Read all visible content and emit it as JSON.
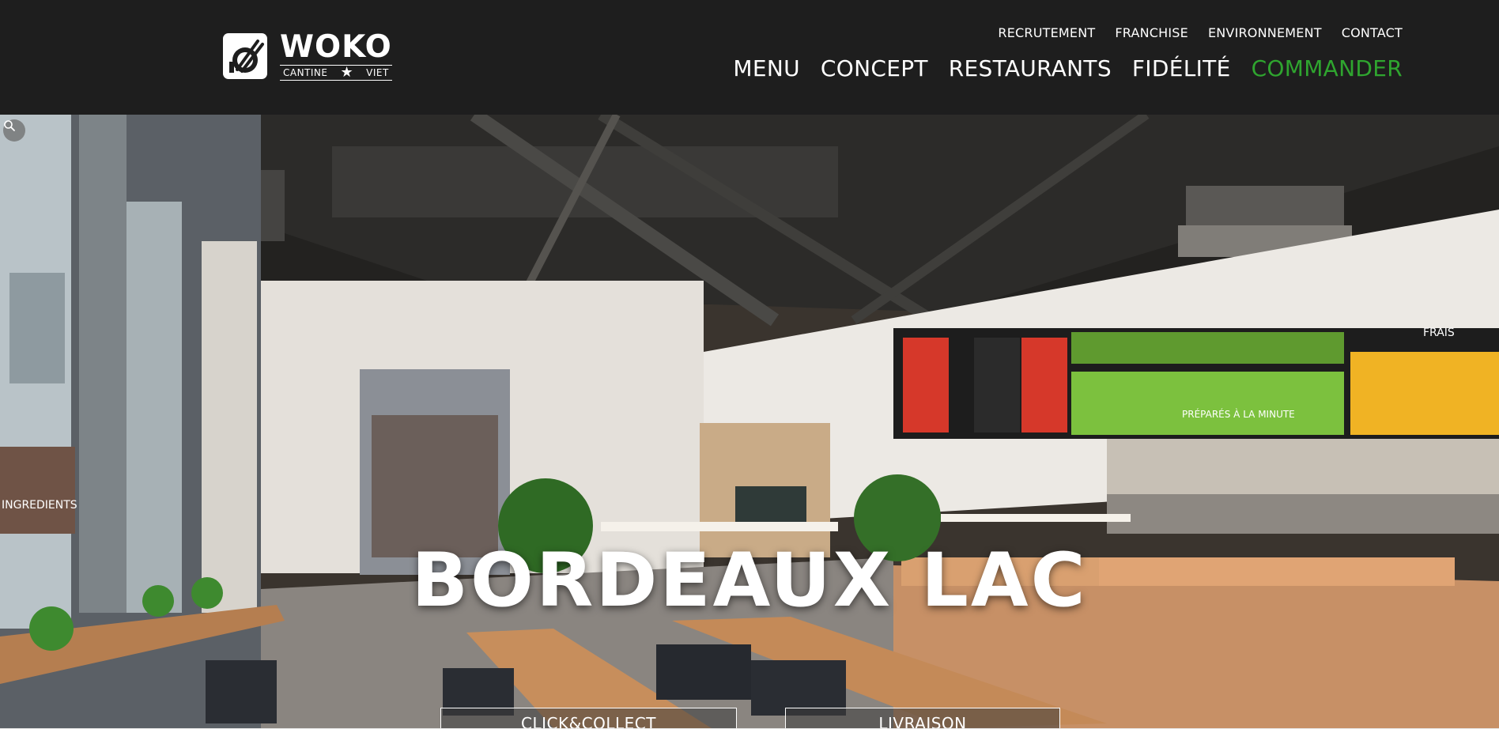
{
  "brand": {
    "logo_word": "WOKO",
    "logo_sub_left": "CANTINE",
    "logo_sub_right": "VIET"
  },
  "top_nav": [
    {
      "label": "RECRUTEMENT"
    },
    {
      "label": "FRANCHISE"
    },
    {
      "label": "ENVIRONNEMENT"
    },
    {
      "label": "CONTACT"
    }
  ],
  "main_nav": [
    {
      "label": "MENU"
    },
    {
      "label": "CONCEPT"
    },
    {
      "label": "RESTAURANTS"
    },
    {
      "label": "FIDÉLITÉ"
    },
    {
      "label": "COMMANDER"
    }
  ],
  "hero": {
    "title": "BORDEAUX LAC",
    "wall_text": "INGREDIENTS",
    "menu_board_1": "FRAIS",
    "menu_board_2": "PRÉPARÉS À LA MINUTE",
    "buttons": {
      "click_collect": "CLICK&COLLECT",
      "livraison": "LIVRAISON"
    }
  },
  "colors": {
    "header_bg": "#1e1e1e",
    "nav_text": "#ffffff",
    "accent_commander": "#2fa52f"
  },
  "icons": {
    "zoom": "search-icon",
    "logo": "chopsticks-bowl-icon"
  }
}
